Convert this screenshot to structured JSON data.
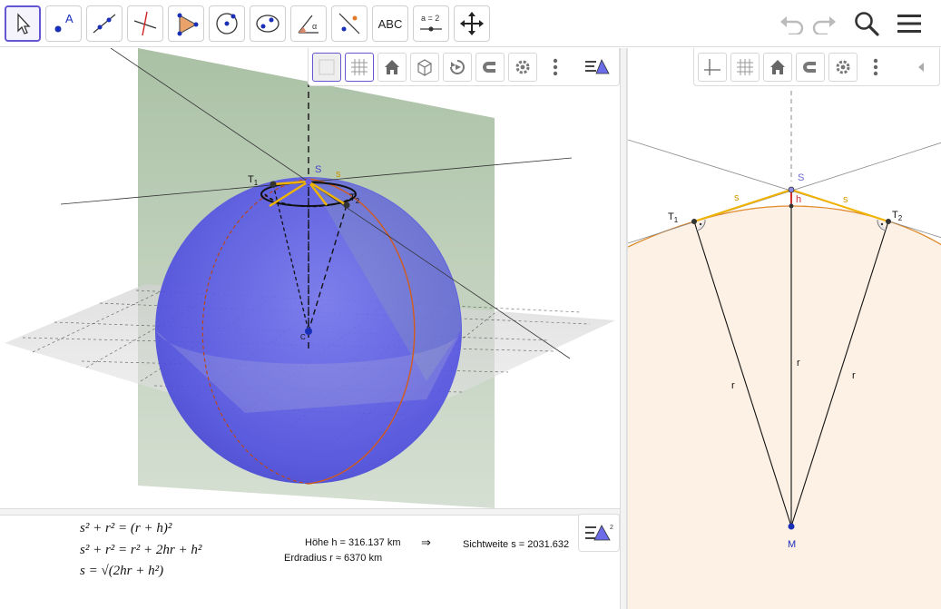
{
  "toolbar": {
    "tools": [
      {
        "name": "move-tool",
        "label": ""
      },
      {
        "name": "point-tool",
        "label": "A"
      },
      {
        "name": "line-tool",
        "label": ""
      },
      {
        "name": "perpendicular-tool",
        "label": ""
      },
      {
        "name": "polygon-tool",
        "label": ""
      },
      {
        "name": "circle-tool",
        "label": ""
      },
      {
        "name": "ellipse-tool",
        "label": ""
      },
      {
        "name": "angle-tool",
        "label": ""
      },
      {
        "name": "reflect-tool",
        "label": ""
      },
      {
        "name": "text-tool",
        "label": "ABC"
      },
      {
        "name": "slider-tool",
        "label": "a = 2"
      },
      {
        "name": "move-graphics-tool",
        "label": ""
      }
    ],
    "active_tool": "move-tool"
  },
  "view3d": {
    "labels": {
      "s_point": "S",
      "s_segment": "s",
      "t1": "T",
      "t1_sub": "1",
      "t2": "T",
      "t2_sub": "2",
      "center": "C"
    }
  },
  "view2d": {
    "labels": {
      "S": "S",
      "h": "h",
      "T1": "T",
      "T1_sub": "1",
      "T2": "T",
      "T2_sub": "2",
      "s_left": "s",
      "s_right": "s",
      "r_left": "r",
      "r_mid": "r",
      "r_right": "r",
      "M": "M"
    }
  },
  "formulas": {
    "line1": "s² + r² = (r + h)²",
    "line2": "s² + r² = r² + 2hr + h²",
    "line3": "s = √(2hr + h²)"
  },
  "info": {
    "hoehe": "Höhe h = 316.137 km",
    "arrow": "⇒",
    "erdradius": "Erdradius r ≈ 6370 km",
    "sichtweite": "Sichtweite s = 2031.632"
  },
  "colors": {
    "accent": "#6557d2",
    "sphere": "#5050e0",
    "tangent": "#f0b400",
    "earth_fill": "#fdf0e4",
    "earth_edge": "#e08a2c",
    "plane_green": "#8fae88"
  }
}
